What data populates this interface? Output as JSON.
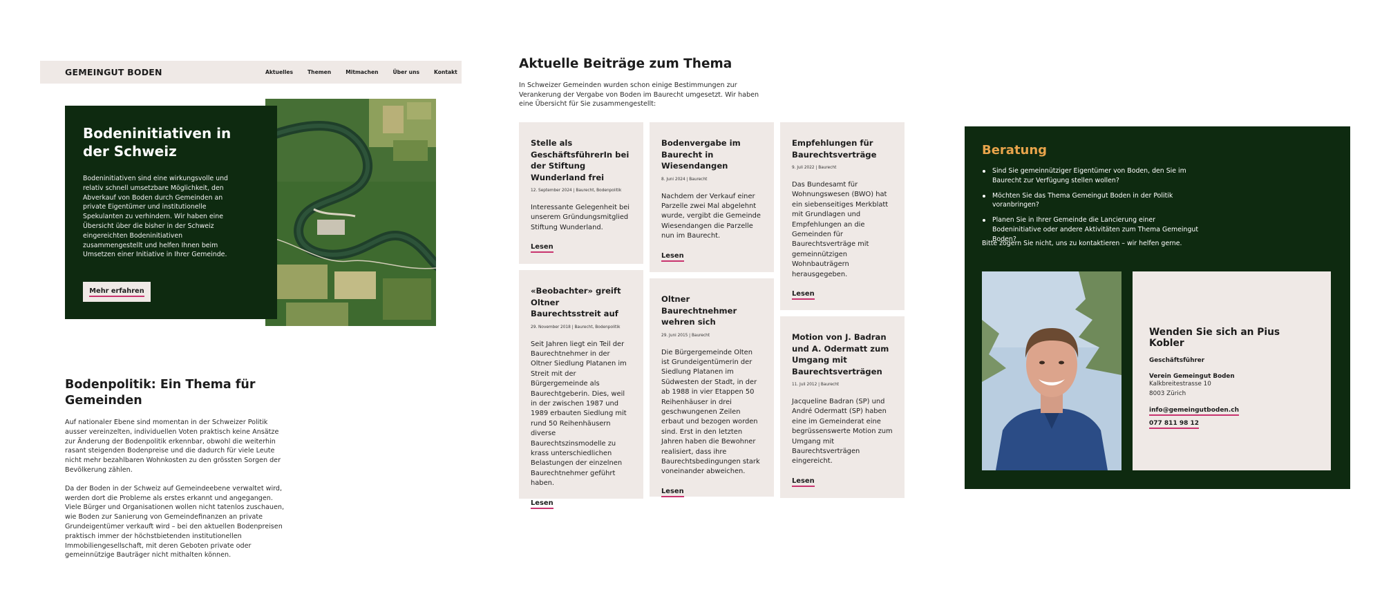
{
  "header": {
    "brand": "GEMEINGUT BODEN",
    "nav": [
      "Aktuelles",
      "Themen",
      "Mitmachen",
      "Über uns",
      "Kontakt"
    ]
  },
  "hero": {
    "title": "Bodeninitiativen in der Schweiz",
    "text": "Bodeninitiativen sind eine wirkungsvolle und relativ schnell umsetzbare Möglichkeit, den Abverkauf von Boden durch Gemeinden an private Eigentümer und institutionelle Spekulanten zu verhindern. Wir haben eine Übersicht über die bisher in der Schweiz eingereichten Bodeninitiativen zusammengestellt und helfen Ihnen beim Umsetzen einer Initiative in Ihrer Gemeinde.",
    "button": "Mehr erfahren"
  },
  "politik": {
    "title": "Bodenpolitik: Ein Thema für Gemeinden",
    "p1": "Auf nationaler Ebene sind momentan in der Schweizer Politik ausser vereinzelten, individuellen Voten praktisch keine Ansätze zur Änderung der Bodenpolitik erkennbar, obwohl die weiterhin rasant steigenden Bodenpreise und die dadurch für viele Leute nicht mehr bezahlbaren Wohnkosten zu den grössten Sorgen der Bevölkerung zählen.",
    "p2": "Da der Boden in der Schweiz auf Gemeindeebene verwaltet wird, werden dort die Probleme als erstes erkannt und angegangen. Viele Bürger und Organisationen wollen nicht tatenlos zuschauen, wie Boden zur Sanierung von Gemeindefinanzen an private Grundeigentümer verkauft wird – bei den aktuellen Bodenpreisen praktisch immer der höchstbietenden  institutionellen Immobiliengesellschaft, mit deren Geboten private oder gemeinnützige Bauträger nicht mithalten können."
  },
  "articles": {
    "title": "Aktuelle Beiträge zum Thema",
    "intro": "In Schweizer Gemeinden wurden schon einige Bestimmungen zur Verankerung der Vergabe von Boden im Baurecht umgesetzt. Wir haben eine Übersicht für Sie zusammengestellt:",
    "read_label": "Lesen",
    "items": [
      {
        "title": "Stelle als GeschäftsführerIn bei der Stiftung Wunderland frei",
        "meta": "12. September 2024 | Baurecht, Bodenpolitik",
        "excerpt": "Interessante Gelegenheit bei unserem Gründungsmitglied Stiftung Wunderland."
      },
      {
        "title": "«Beobachter» greift Oltner Baurechtsstreit auf",
        "meta": "29. November 2018 | Baurecht, Bodenpolitik",
        "excerpt": "Seit Jahren liegt ein Teil der Baurechtnehmer in der Oltner Siedlung Platanen im Streit mit der Bürgergemeinde als Baurechtgeberin. Dies, weil in der zwischen 1987 und 1989 erbauten Siedlung mit rund 50 Reihenhäusern diverse Baurechtszinsmodelle zu krass unterschiedlichen Belastungen der einzelnen Baurechtnehmer geführt haben."
      },
      {
        "title": "Bodenvergabe im Baurecht in Wiesendangen",
        "meta": "8. Juni 2024 | Baurecht",
        "excerpt": "Nachdem der Verkauf einer Parzelle zwei Mal abgelehnt wurde, vergibt die Gemeinde Wiesendangen die Parzelle nun im Baurecht."
      },
      {
        "title": "Oltner Baurechtnehmer wehren sich",
        "meta": "29. Juni 2015 | Baurecht",
        "excerpt": "Die Bürgergemeinde Olten ist Grundeigentümerin der Siedlung Platanen im Südwesten der Stadt, in der ab 1988 in vier Etappen 50 Reihenhäuser in drei geschwungenen Zeilen erbaut und bezogen worden sind. Erst in den letzten Jahren haben die Bewohner realisiert, dass ihre Baurechtsbedingungen stark voneinander abweichen."
      },
      {
        "title": "Empfehlungen für Baurechtsverträge",
        "meta": "9. Juli 2022 | Baurecht",
        "excerpt": "Das Bundesamt für Wohnungswesen (BWO) hat ein siebenseitiges Merkblatt mit Grundlagen und Empfehlungen an die Gemeinden für Baurechtsverträge mit gemeinnützigen Wohnbauträgern herausgegeben."
      },
      {
        "title": "Motion von J. Badran und A. Odermatt zum Umgang mit Baurechtsverträgen",
        "meta": "11. Juli 2012 | Baurecht",
        "excerpt": "Jacqueline Badran (SP) und André Odermatt (SP) haben eine im Gemeinderat eine begrüssenswerte Motion zum Umgang mit Baurechtsverträgen eingereicht."
      }
    ]
  },
  "beratung": {
    "title": "Beratung",
    "bullets": [
      "Sind Sie gemeinnütziger Eigentümer von Boden, den Sie im Baurecht zur Verfügung stellen wollen?",
      "Möchten Sie das Thema Gemeingut Boden in der Politik voranbringen?",
      "Planen Sie in Ihrer Gemeinde die Lancierung einer Bodeninitiative oder andere Aktivitäten zum Thema Gemeingut Boden?"
    ],
    "note": "Bitte zögern Sie nicht, uns zu kontaktieren – wir helfen gerne.",
    "contact": {
      "heading": "Wenden Sie sich an Pius Kobler",
      "role": "Geschäftsführer",
      "org": "Verein Gemeingut Boden",
      "street": "Kalkbreitestrasse 10",
      "city": "8003 Zürich",
      "email": "info@gemeingutboden.ch",
      "phone": "077 811 98 12"
    }
  },
  "colors": {
    "dark_green": "#0e2a10",
    "beige": "#efe9e6",
    "accent_pink": "#c8336e",
    "accent_orange": "#e8a44b"
  }
}
